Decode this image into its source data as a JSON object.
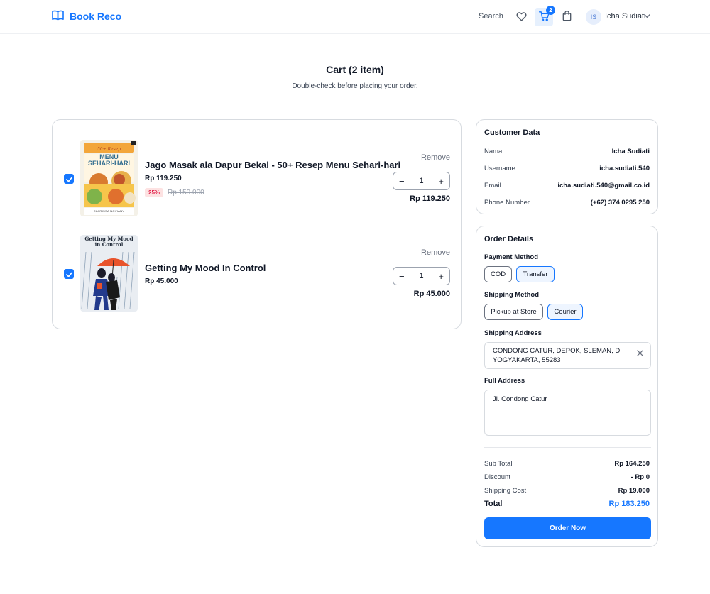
{
  "header": {
    "brand": "Book Reco",
    "search_label": "Search",
    "cart_count": "2",
    "user_initials": "IS",
    "user_name": "Icha Sudiati"
  },
  "page": {
    "title": "Cart (2 item)",
    "subtitle": "Double-check before placing your order."
  },
  "cart": {
    "items": [
      {
        "title": "Jago Masak ala Dapur Bekal - 50+ Resep Menu Sehari-hari",
        "price": "Rp 119.250",
        "discount": "25%",
        "old_price": "Rp 159.000",
        "remove_label": "Remove",
        "quantity": "1",
        "line_total": "Rp 119.250",
        "checked": true,
        "cover_text": {
          "top": "50+ Resep",
          "main1": "MENU",
          "main2": "SEHARI-HARI",
          "author": "CLARISSA NOVIANY"
        }
      },
      {
        "title": "Getting My Mood In Control",
        "price": "Rp 45.000",
        "remove_label": "Remove",
        "quantity": "1",
        "line_total": "Rp 45.000",
        "checked": true,
        "cover_text": {
          "line1": "Getting My Mood",
          "line2": "in Control"
        }
      }
    ]
  },
  "customer": {
    "title": "Customer Data",
    "fields": [
      {
        "label": "Nama",
        "value": "Icha Sudiati"
      },
      {
        "label": "Username",
        "value": "icha.sudiati.540"
      },
      {
        "label": "Email",
        "value": "icha.sudiati.540@gmail.co.id"
      },
      {
        "label": "Phone Number",
        "value": "(+62) 374 0295 250"
      }
    ]
  },
  "order": {
    "title": "Order Details",
    "payment_label": "Payment Method",
    "payment_options": [
      "COD",
      "Transfer"
    ],
    "payment_selected": "Transfer",
    "shipping_label": "Shipping Method",
    "shipping_options": [
      "Pickup at Store",
      "Courier"
    ],
    "shipping_selected": "Courier",
    "address_label": "Shipping Address",
    "address_value": "CONDONG CATUR, DEPOK, SLEMAN, DI YOGYAKARTA, 55283",
    "full_address_label": "Full Address",
    "full_address_value": "Jl. Condong Catur",
    "summary": [
      {
        "label": "Sub Total",
        "value": "Rp 164.250"
      },
      {
        "label": "Discount",
        "value": "- Rp 0"
      },
      {
        "label": "Shipping Cost",
        "value": "Rp 19.000"
      }
    ],
    "total_label": "Total",
    "total_value": "Rp 183.250",
    "order_button": "Order Now"
  },
  "colors": {
    "accent": "#1677ff",
    "discount_badge_bg": "#fde2e2",
    "discount_badge_text": "#e11d48",
    "border": "#d7dbe0"
  },
  "icons": [
    "book-open-icon",
    "heart-icon",
    "cart-icon",
    "bag-icon",
    "chevron-down-icon",
    "check-icon",
    "close-icon",
    "minus-icon",
    "plus-icon"
  ]
}
